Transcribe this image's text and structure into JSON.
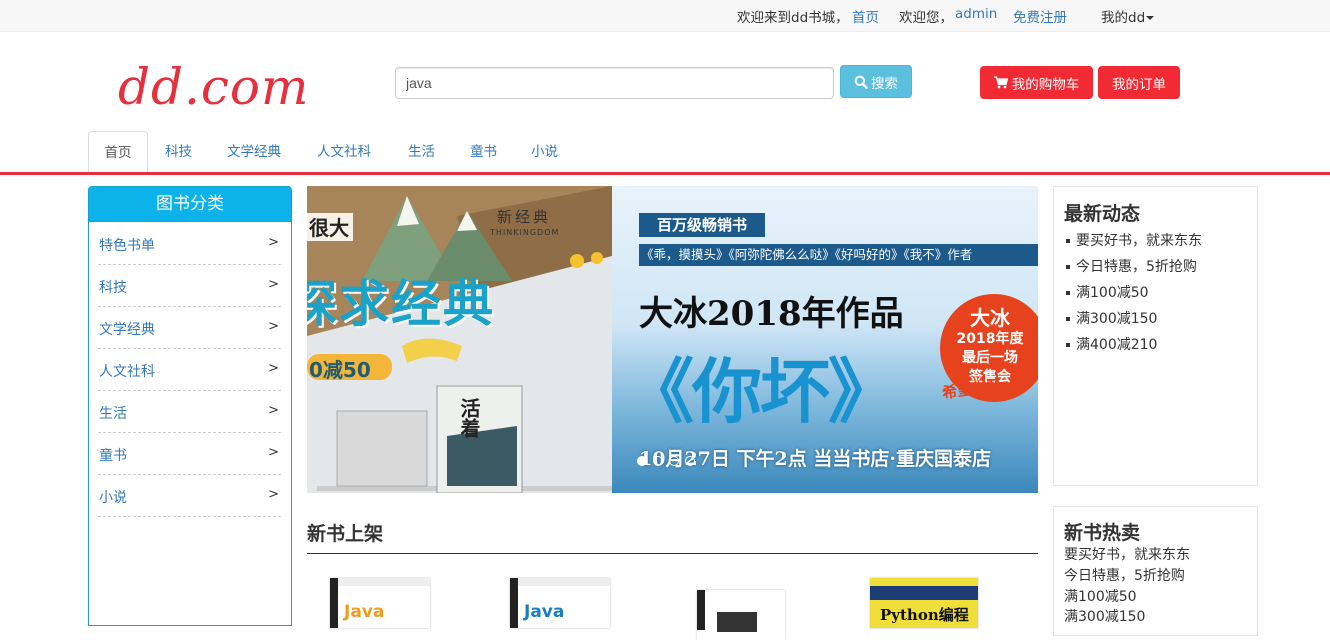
{
  "topbar": {
    "welcome": "欢迎来到dd书城，",
    "home_link": "首页",
    "hello": "欢迎您，",
    "user": "admin",
    "register": "免费注册",
    "my_menu": "我的dd"
  },
  "header": {
    "logo": "dd.com",
    "search_value": "java",
    "search_button": "搜索",
    "cart_button": "我的购物车",
    "orders_button": "我的订单"
  },
  "nav": {
    "tabs": [
      "首页",
      "科技",
      "文学经典",
      "人文社科",
      "生活",
      "童书",
      "小说"
    ]
  },
  "sidebar": {
    "title": "图书分类",
    "items": [
      "特色书单",
      "科技",
      "文学经典",
      "人文社科",
      "生活",
      "童书",
      "小说"
    ],
    "arrow": ">"
  },
  "banner": {
    "left": {
      "brand": "新经典",
      "brand_en": "THINKINGDOM",
      "headline": "探求经典",
      "corner": "很大",
      "promo": "0减50",
      "book_title": "活着"
    },
    "right": {
      "tag": "百万级畅销书",
      "titles_line": "《乖，摸摸头》《阿弥陀佛么么哒》《好吗好的》《我不》作者",
      "headline": "大冰2018年作品",
      "book": "《你坏》",
      "badge_1": "大冰",
      "badge_2": "2018年度",
      "badge_3": "最后一场",
      "badge_4": "签售会",
      "slogan": "希望你开",
      "event": "10月27日  下午2点  当当书店·重庆国泰店"
    }
  },
  "new_books": {
    "title": "新书上架",
    "covers": [
      "Java",
      "Java",
      "",
      "Python编程"
    ]
  },
  "latest_news": {
    "title": "最新动态",
    "items": [
      "要买好书，就来东东",
      "今日特惠，5折抢购",
      "满100减50",
      "满300减150",
      "满400减210"
    ]
  },
  "hot_books": {
    "title": "新书热卖",
    "items": [
      "要买好书，就来东东",
      "今日特惠，5折抢购",
      "满100减50",
      "满300减150"
    ]
  },
  "colors": {
    "brand_red": "#e6303d",
    "button_red": "#f12a34",
    "info_blue": "#5bc0de",
    "sidebar_blue": "#0bb3ea",
    "link_blue": "#337ab7"
  }
}
